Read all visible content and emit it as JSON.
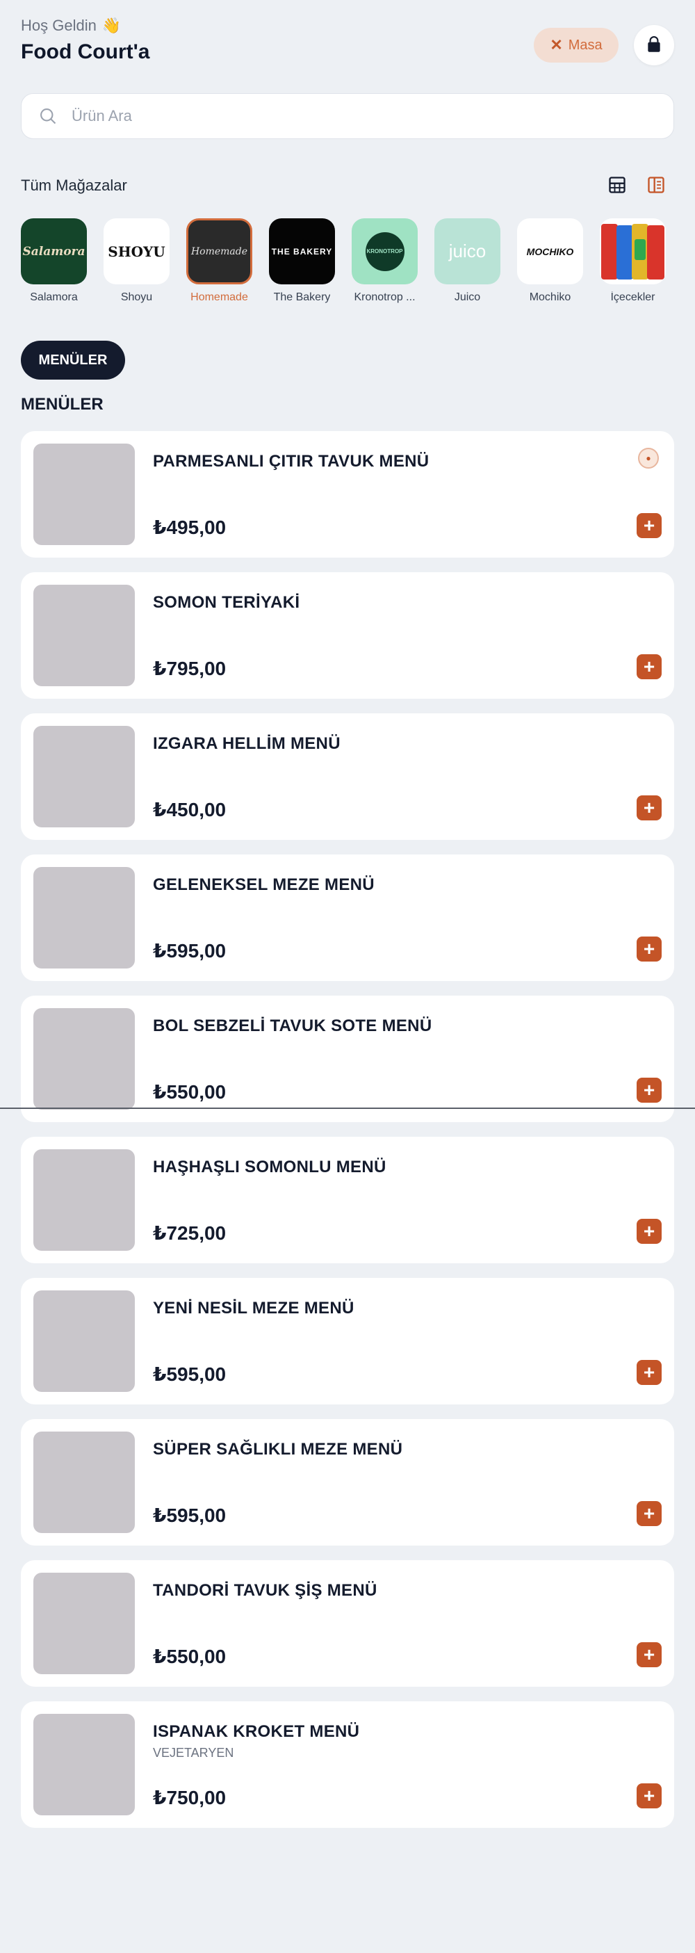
{
  "header": {
    "greeting": "Hoş Geldin",
    "title": "Food Court'a",
    "masa_label": "Masa"
  },
  "search": {
    "placeholder": "Ürün Ara"
  },
  "stores": {
    "title": "Tüm Mağazalar",
    "items": [
      {
        "name": "Salamora",
        "logo_text": "Salamora",
        "bg": "#14452a",
        "fg": "#e9dcc0"
      },
      {
        "name": "Shoyu",
        "logo_text": "SHOYU",
        "bg": "#ffffff",
        "fg": "#111111"
      },
      {
        "name": "Homemade",
        "logo_text": "Homemade",
        "bg": "#2a2a2a",
        "fg": "#e0e0e0"
      },
      {
        "name": "The Bakery",
        "logo_text": "THE BAKERY",
        "bg": "#050505",
        "fg": "#ffffff"
      },
      {
        "name": "Kronotrop ...",
        "logo_text": "KRONOTROP",
        "bg": "#9fe2c3",
        "fg": "#0f3a28"
      },
      {
        "name": "Juico",
        "logo_text": "juico",
        "bg": "#b9e3d6",
        "fg": "#ffffff"
      },
      {
        "name": "Mochiko",
        "logo_text": "MOCHIKO",
        "bg": "#ffffff",
        "fg": "#111111"
      },
      {
        "name": "İçecekler",
        "logo_text": "",
        "bg": "#d9342b",
        "fg": "#ffffff"
      }
    ]
  },
  "category": {
    "pill_label": "MENÜLER",
    "section_title": "MENÜLER"
  },
  "menu": [
    {
      "name": "PARMESANLI ÇITIR TAVUK MENÜ",
      "tag": "",
      "price": "₺495,00",
      "badge": true
    },
    {
      "name": "SOMON TERİYAKİ",
      "tag": "",
      "price": "₺795,00",
      "badge": false
    },
    {
      "name": "IZGARA HELLİM MENÜ",
      "tag": "",
      "price": "₺450,00",
      "badge": false
    },
    {
      "name": "GELENEKSEL MEZE MENÜ",
      "tag": "",
      "price": "₺595,00",
      "badge": false
    },
    {
      "name": "BOL SEBZELİ TAVUK SOTE MENÜ",
      "tag": "",
      "price": "₺550,00",
      "badge": false
    },
    {
      "name": "HAŞHAŞLI SOMONLU MENÜ",
      "tag": "",
      "price": "₺725,00",
      "badge": false
    },
    {
      "name": "YENİ NESİL MEZE MENÜ",
      "tag": "",
      "price": "₺595,00",
      "badge": false
    },
    {
      "name": "SÜPER SAĞLIKLI MEZE MENÜ",
      "tag": "",
      "price": "₺595,00",
      "badge": false
    },
    {
      "name": "TANDORİ TAVUK ŞİŞ MENÜ",
      "tag": "",
      "price": "₺550,00",
      "badge": false
    },
    {
      "name": "ISPANAK KROKET MENÜ",
      "tag": "VEJETARYEN",
      "price": "₺750,00",
      "badge": false
    }
  ],
  "colors": {
    "accent": "#c45427",
    "dark": "#141b2d",
    "background": "#edf0f4"
  }
}
